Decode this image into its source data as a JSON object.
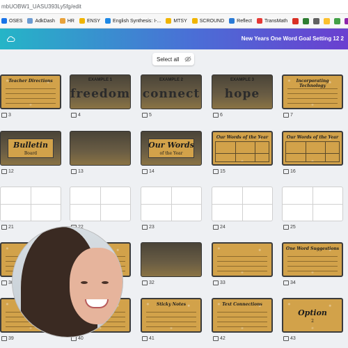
{
  "browser": {
    "url": "mbUOBW1_UASU393Ly5fg/edit"
  },
  "bookmarks": [
    {
      "label": "OSES",
      "color": "#1a73e8"
    },
    {
      "label": "AdkDash",
      "color": "#6c9bd2"
    },
    {
      "label": "HR",
      "color": "#e8a23a"
    },
    {
      "label": "ENSY",
      "color": "#f0b400"
    },
    {
      "label": "English Synthesis: I-...",
      "color": "#1e88e5"
    },
    {
      "label": "MTSY",
      "color": "#f0b400"
    },
    {
      "label": "SCROUND",
      "color": "#f0b400"
    },
    {
      "label": "Reflect",
      "color": "#2b7bd6"
    },
    {
      "label": "TransMath",
      "color": "#e53935"
    }
  ],
  "bookmark_icons": [
    {
      "name": "gmail-icon",
      "color": "#d93025"
    },
    {
      "name": "keep-icon",
      "color": "#2e7d32"
    },
    {
      "name": "bookmark-app-icon",
      "color": "#616161"
    },
    {
      "name": "note-icon",
      "color": "#fbc02d"
    },
    {
      "name": "drive-icon",
      "color": "#43a047"
    },
    {
      "name": "app-icon",
      "color": "#8e24aa"
    }
  ],
  "header": {
    "title": "New Years One Word Goal Setting 12 2"
  },
  "select_all": {
    "label": "Select all",
    "icon": "eye-off-icon"
  },
  "slides": [
    {
      "num": "3",
      "type": "gold",
      "title": "Teacher Directions"
    },
    {
      "num": "4",
      "type": "dark",
      "label": "EXAMPLE 1",
      "word": "freedom"
    },
    {
      "num": "5",
      "type": "dark",
      "label": "EXAMPLE 2",
      "word": "connect"
    },
    {
      "num": "6",
      "type": "dark",
      "label": "EXAMPLE 3",
      "word": "hope"
    },
    {
      "num": "7",
      "type": "gold",
      "title": "Incorporating Technology"
    },
    {
      "num": "12",
      "type": "dark",
      "word": "Bulletin",
      "sub": "Board"
    },
    {
      "num": "13",
      "type": "dark"
    },
    {
      "num": "14",
      "type": "dark",
      "word": "Our Words",
      "sub": "of the Year"
    },
    {
      "num": "15",
      "type": "goldtable",
      "title": "Our Words of the Year"
    },
    {
      "num": "16",
      "type": "goldtable",
      "title": "Our Words of the Year"
    },
    {
      "num": "21",
      "type": "white"
    },
    {
      "num": "22",
      "type": "white"
    },
    {
      "num": "23",
      "type": "white"
    },
    {
      "num": "24",
      "type": "white"
    },
    {
      "num": "25",
      "type": "white"
    },
    {
      "num": "30",
      "type": "gold"
    },
    {
      "num": "31",
      "type": "gold"
    },
    {
      "num": "32",
      "type": "dark"
    },
    {
      "num": "33",
      "type": "gold"
    },
    {
      "num": "34",
      "type": "gold",
      "title": "One Word Suggestions"
    },
    {
      "num": "39",
      "type": "gold"
    },
    {
      "num": "40",
      "type": "gold"
    },
    {
      "num": "41",
      "type": "gold",
      "title": "Sticky Notes"
    },
    {
      "num": "42",
      "type": "gold",
      "title": "Text Connections"
    },
    {
      "num": "43",
      "type": "gold",
      "word": "Option",
      "sub": "2"
    }
  ]
}
